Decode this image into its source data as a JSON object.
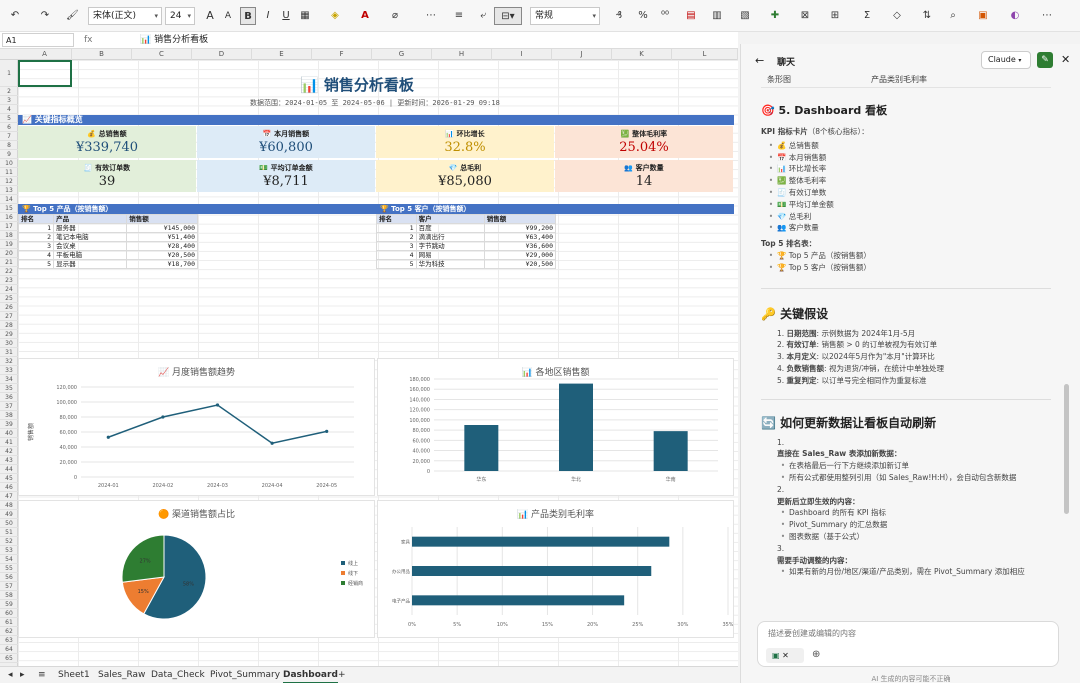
{
  "toolbar": {
    "font_name": "宋体(正文)",
    "font_size": "24",
    "number_format": "常规",
    "bold_label": "B",
    "italic_label": "I",
    "underline_label": "U",
    "increase_font": "A",
    "decrease_font": "A"
  },
  "formula_bar": {
    "cell_ref": "A1",
    "fx": "fx",
    "value": "📊 销售分析看板"
  },
  "columns": [
    "A",
    "B",
    "C",
    "D",
    "E",
    "F",
    "G",
    "H",
    "I",
    "J",
    "K",
    "L"
  ],
  "rows": [
    "1",
    "2",
    "3",
    "4",
    "5",
    "6",
    "7",
    "8",
    "9",
    "10",
    "11",
    "12",
    "13",
    "14",
    "15",
    "16",
    "17",
    "18",
    "19",
    "20",
    "21",
    "22",
    "23",
    "24",
    "25",
    "26",
    "27",
    "28",
    "29",
    "30",
    "31",
    "32",
    "33",
    "34",
    "35",
    "36",
    "37",
    "38",
    "39",
    "40",
    "41",
    "42",
    "43",
    "44",
    "45",
    "46",
    "47",
    "48",
    "49",
    "50",
    "51",
    "52",
    "53",
    "54",
    "55",
    "56",
    "57",
    "58",
    "59",
    "60",
    "61",
    "62",
    "63",
    "64",
    "65"
  ],
  "dashboard": {
    "title": "📊 销售分析看板",
    "subtitle": "数据范围：2024-01-05 至 2024-05-06  |  更新时间：2026-01-29 09:18",
    "kpi_section": "📈 关键指标概览",
    "kpis": [
      {
        "label": "💰 总销售额",
        "value": "¥339,740",
        "color": "#1f4e79",
        "bg": "#e2efda"
      },
      {
        "label": "📅 本月销售额",
        "value": "¥60,800",
        "color": "#1f4e79",
        "bg": "#ddebf7"
      },
      {
        "label": "📊 环比增长",
        "value": "32.8%",
        "color": "#bf8f00",
        "bg": "#fff2cc"
      },
      {
        "label": "💹 整体毛利率",
        "value": "25.04%",
        "color": "#c00000",
        "bg": "#fce4d6"
      },
      {
        "label": "🧾 有效订单数",
        "value": "39",
        "color": "#222222",
        "bg": "#e2efda"
      },
      {
        "label": "💵 平均订单金额",
        "value": "¥8,711",
        "color": "#222222",
        "bg": "#ddebf7"
      },
      {
        "label": "💎 总毛利",
        "value": "¥85,080",
        "color": "#222222",
        "bg": "#fff2cc"
      },
      {
        "label": "👥 客户数量",
        "value": "14",
        "color": "#222222",
        "bg": "#fce4d6"
      }
    ],
    "top_products": {
      "title": "🏆 Top 5 产品（按销售额）",
      "headers": [
        "排名",
        "产品",
        "销售额"
      ],
      "rows": [
        [
          "1",
          "服务器",
          "¥145,000"
        ],
        [
          "2",
          "笔记本电脑",
          "¥51,400"
        ],
        [
          "3",
          "会议桌",
          "¥28,400"
        ],
        [
          "4",
          "平板电脑",
          "¥20,500"
        ],
        [
          "5",
          "显示器",
          "¥18,700"
        ]
      ]
    },
    "top_customers": {
      "title": "🏆 Top 5 客户（按销售额）",
      "headers": [
        "排名",
        "客户",
        "销售额"
      ],
      "rows": [
        [
          "1",
          "百度",
          "¥99,200"
        ],
        [
          "2",
          "滴滴出行",
          "¥63,400"
        ],
        [
          "3",
          "字节跳动",
          "¥36,600"
        ],
        [
          "4",
          "网易",
          "¥29,000"
        ],
        [
          "5",
          "华为科技",
          "¥20,500"
        ]
      ]
    }
  },
  "chart_data": [
    {
      "type": "line",
      "title": "📈 月度销售额趋势",
      "ylabel": "销售额",
      "categories": [
        "2024-01",
        "2024-02",
        "2024-03",
        "2024-04",
        "2024-05"
      ],
      "values": [
        53000,
        80000,
        96000,
        45000,
        60800
      ],
      "ylim": [
        0,
        120000
      ],
      "yticks": [
        "0",
        "20,000",
        "40,000",
        "60,000",
        "80,000",
        "100,000",
        "120,000"
      ],
      "color": "#1f5f7a",
      "grid": true
    },
    {
      "type": "bar",
      "title": "📊 各地区销售额",
      "categories": [
        "华东",
        "华北",
        "华南"
      ],
      "values": [
        90000,
        171000,
        78000
      ],
      "ylim": [
        0,
        180000
      ],
      "yticks": [
        "0",
        "20,000",
        "40,000",
        "60,000",
        "80,000",
        "100,000",
        "120,000",
        "140,000",
        "160,000",
        "180,000"
      ],
      "color": "#1f5f7a",
      "grid": true
    },
    {
      "type": "pie",
      "title": "🟠 渠道销售额占比",
      "categories": [
        "线上",
        "线下",
        "经销商"
      ],
      "values": [
        58,
        15,
        27
      ],
      "labels": [
        "58%",
        "15%",
        "27%"
      ],
      "colors": [
        "#1f5f7a",
        "#ed7d31",
        "#2e7d32"
      ],
      "legend": "right"
    },
    {
      "type": "bar",
      "orientation": "horizontal",
      "title": "📊 产品类别毛利率",
      "categories": [
        "家具",
        "办公用品",
        "电子产品"
      ],
      "values": [
        28.5,
        26.5,
        23.5
      ],
      "xlim": [
        0,
        35
      ],
      "xticks": [
        "0%",
        "5%",
        "10%",
        "15%",
        "20%",
        "25%",
        "30%",
        "35%"
      ],
      "color": "#1f5f7a",
      "grid": true
    }
  ],
  "sheet_tabs": [
    "Sheet1",
    "Sales_Raw",
    "Data_Check",
    "Pivot_Summary",
    "Dashboard"
  ],
  "active_tab": "Dashboard",
  "panel": {
    "title": "聊天",
    "model": "Claude",
    "top_table": [
      "条形图",
      "产品类别毛利率"
    ],
    "section5_title": "🎯 5. Dashboard 看板",
    "kpi_intro": "KPI 指标卡片",
    "kpi_intro_note": "（8个核心指标）：",
    "kpi_items": [
      "💰 总销售额",
      "📅 本月销售额",
      "📊 环比增长率",
      "💹 整体毛利率",
      "🧾 有效订单数",
      "💵 平均订单金额",
      "💎 总毛利",
      "👥 客户数量"
    ],
    "top5_intro": "Top 5 排名表：",
    "top5_items": [
      "🏆 Top 5 产品（按销售额）",
      "🏆 Top 5 客户（按销售额）"
    ],
    "assumptions_title": "🔑 关键假设",
    "assumptions": [
      {
        "key": "日期范围",
        "text": ": 示例数据为 2024年1月-5月"
      },
      {
        "key": "有效订单",
        "text": ": 销售额 > 0 的订单被视为有效订单"
      },
      {
        "key": "本月定义",
        "text": ": 以2024年5月作为\"本月\"计算环比"
      },
      {
        "key": "负数销售额",
        "text": ": 视为退货/冲销，在统计中单独处理"
      },
      {
        "key": "重复判定",
        "text": ": 以订单号完全相同作为重复标准"
      }
    ],
    "refresh_title": "🔄 如何更新数据让看板自动刷新",
    "step1_num": "1.",
    "step1_title": "直接在 Sales_Raw 表添加新数据：",
    "step1_items": [
      "在表格最后一行下方继续添加新订单",
      "所有公式都使用整列引用（如 Sales_Raw!H:H），会自动包含新数据"
    ],
    "step2_num": "2.",
    "step2_title": "更新后立即生效的内容：",
    "step2_items": [
      "Dashboard 的所有 KPI 指标",
      "Pivot_Summary 的汇总数据",
      "图表数据（基于公式）"
    ],
    "step3_num": "3.",
    "step3_title": "需要手动调整的内容：",
    "step3_items": [
      "如果有新的月份/地区/渠道/产品类别，需在 Pivot_Summary 添加相应"
    ],
    "input_placeholder": "描述要创建或编辑的内容",
    "disclaimer": "AI 生成的内容可能不正确"
  }
}
